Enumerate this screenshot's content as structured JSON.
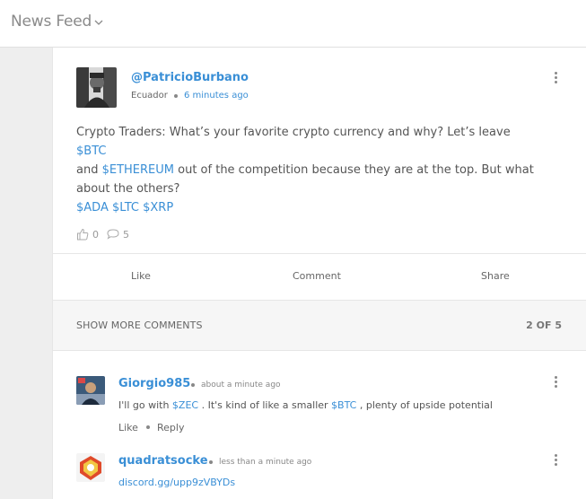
{
  "header": {
    "title": "News Feed"
  },
  "post": {
    "handle": "@PatricioBurbano",
    "country": "Ecuador",
    "time": "6 minutes ago",
    "text_1": "Crypto Traders: What’s your favorite crypto currency and why? Let’s leave ",
    "tag_btc": "$BTC",
    "text_2": "and ",
    "tag_eth": "$ETHEREUM",
    "text_3": " out of the competition because they are at the top. But what about the others?",
    "tag_ada": "$ADA",
    "tag_ltc": "$LTC",
    "tag_xrp": "$XRP",
    "likes_count": "0",
    "comments_count": "5"
  },
  "actions": {
    "like": "Like",
    "comment": "Comment",
    "share": "Share"
  },
  "comments_bar": {
    "show_more": "SHOW MORE COMMENTS",
    "count": "2 OF 5"
  },
  "comments": [
    {
      "name": "Giorgio985",
      "time": "about a minute ago",
      "text_1": "I'll go with ",
      "tag_1": "$ZEC",
      "text_2": " . It's kind of like a smaller ",
      "tag_2": "$BTC",
      "text_3": " , plenty of upside potential",
      "like": "Like",
      "reply": "Reply"
    },
    {
      "name": "quadratsocke",
      "time": "less than a minute ago",
      "link": "discord.gg/upp9zVBYDs"
    }
  ],
  "colors": {
    "link": "#3a8fd6",
    "background": "#eeeeee",
    "card": "#ffffff"
  }
}
